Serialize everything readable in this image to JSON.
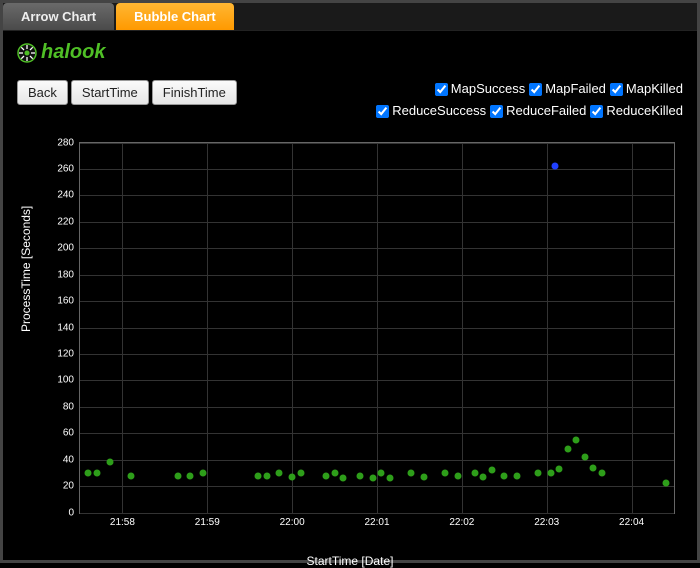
{
  "tabs": {
    "arrow": "Arrow Chart",
    "bubble": "Bubble Chart"
  },
  "brand": "halook",
  "buttons": {
    "back": "Back",
    "start": "StartTime",
    "finish": "FinishTime"
  },
  "legend": [
    {
      "key": "mapsuccess",
      "label": "MapSuccess"
    },
    {
      "key": "mapfailed",
      "label": "MapFailed"
    },
    {
      "key": "mapkilled",
      "label": "MapKilled"
    },
    {
      "key": "reducesuccess",
      "label": "ReduceSuccess"
    },
    {
      "key": "reducefailed",
      "label": "ReduceFailed"
    },
    {
      "key": "reducekilled",
      "label": "ReduceKilled"
    }
  ],
  "chart_data": {
    "type": "scatter",
    "title": "",
    "xlabel": "StartTime [Date]",
    "ylabel": "ProcessTime [Seconds]",
    "ylim": [
      0,
      280
    ],
    "yticks": [
      0,
      20,
      40,
      60,
      80,
      100,
      120,
      140,
      160,
      180,
      200,
      220,
      240,
      260,
      280
    ],
    "xlim": [
      "21:57.5",
      "22:04.5"
    ],
    "xticks": [
      "21:58",
      "21:59",
      "22:00",
      "22:01",
      "22:02",
      "22:03",
      "22:04"
    ],
    "xtick_minutes": [
      58.0,
      59.0,
      60.0,
      61.0,
      62.0,
      63.0,
      64.0
    ],
    "xrange_minutes": [
      57.5,
      64.5
    ],
    "colors": {
      "MapSuccess": "#2e9e1a",
      "ReduceSuccess": "#2040ff"
    },
    "series": [
      {
        "name": "MapSuccess",
        "points": [
          {
            "x": 57.6,
            "y": 30
          },
          {
            "x": 57.7,
            "y": 30
          },
          {
            "x": 57.85,
            "y": 38
          },
          {
            "x": 58.1,
            "y": 28
          },
          {
            "x": 58.65,
            "y": 28
          },
          {
            "x": 58.8,
            "y": 28
          },
          {
            "x": 58.95,
            "y": 30
          },
          {
            "x": 59.6,
            "y": 28
          },
          {
            "x": 59.7,
            "y": 28
          },
          {
            "x": 59.85,
            "y": 30
          },
          {
            "x": 60.0,
            "y": 27
          },
          {
            "x": 60.1,
            "y": 30
          },
          {
            "x": 60.4,
            "y": 28
          },
          {
            "x": 60.5,
            "y": 30
          },
          {
            "x": 60.6,
            "y": 26
          },
          {
            "x": 60.8,
            "y": 28
          },
          {
            "x": 60.95,
            "y": 26
          },
          {
            "x": 61.05,
            "y": 30
          },
          {
            "x": 61.15,
            "y": 26
          },
          {
            "x": 61.4,
            "y": 30
          },
          {
            "x": 61.55,
            "y": 27
          },
          {
            "x": 61.8,
            "y": 30
          },
          {
            "x": 61.95,
            "y": 28
          },
          {
            "x": 62.15,
            "y": 30
          },
          {
            "x": 62.25,
            "y": 27
          },
          {
            "x": 62.35,
            "y": 32
          },
          {
            "x": 62.5,
            "y": 28
          },
          {
            "x": 62.65,
            "y": 28
          },
          {
            "x": 62.9,
            "y": 30
          },
          {
            "x": 63.05,
            "y": 30
          },
          {
            "x": 63.15,
            "y": 33
          },
          {
            "x": 63.25,
            "y": 48
          },
          {
            "x": 63.35,
            "y": 55
          },
          {
            "x": 63.45,
            "y": 42
          },
          {
            "x": 63.55,
            "y": 34
          },
          {
            "x": 63.65,
            "y": 30
          },
          {
            "x": 64.4,
            "y": 22
          }
        ]
      },
      {
        "name": "ReduceSuccess",
        "points": [
          {
            "x": 63.1,
            "y": 262
          }
        ]
      }
    ]
  }
}
